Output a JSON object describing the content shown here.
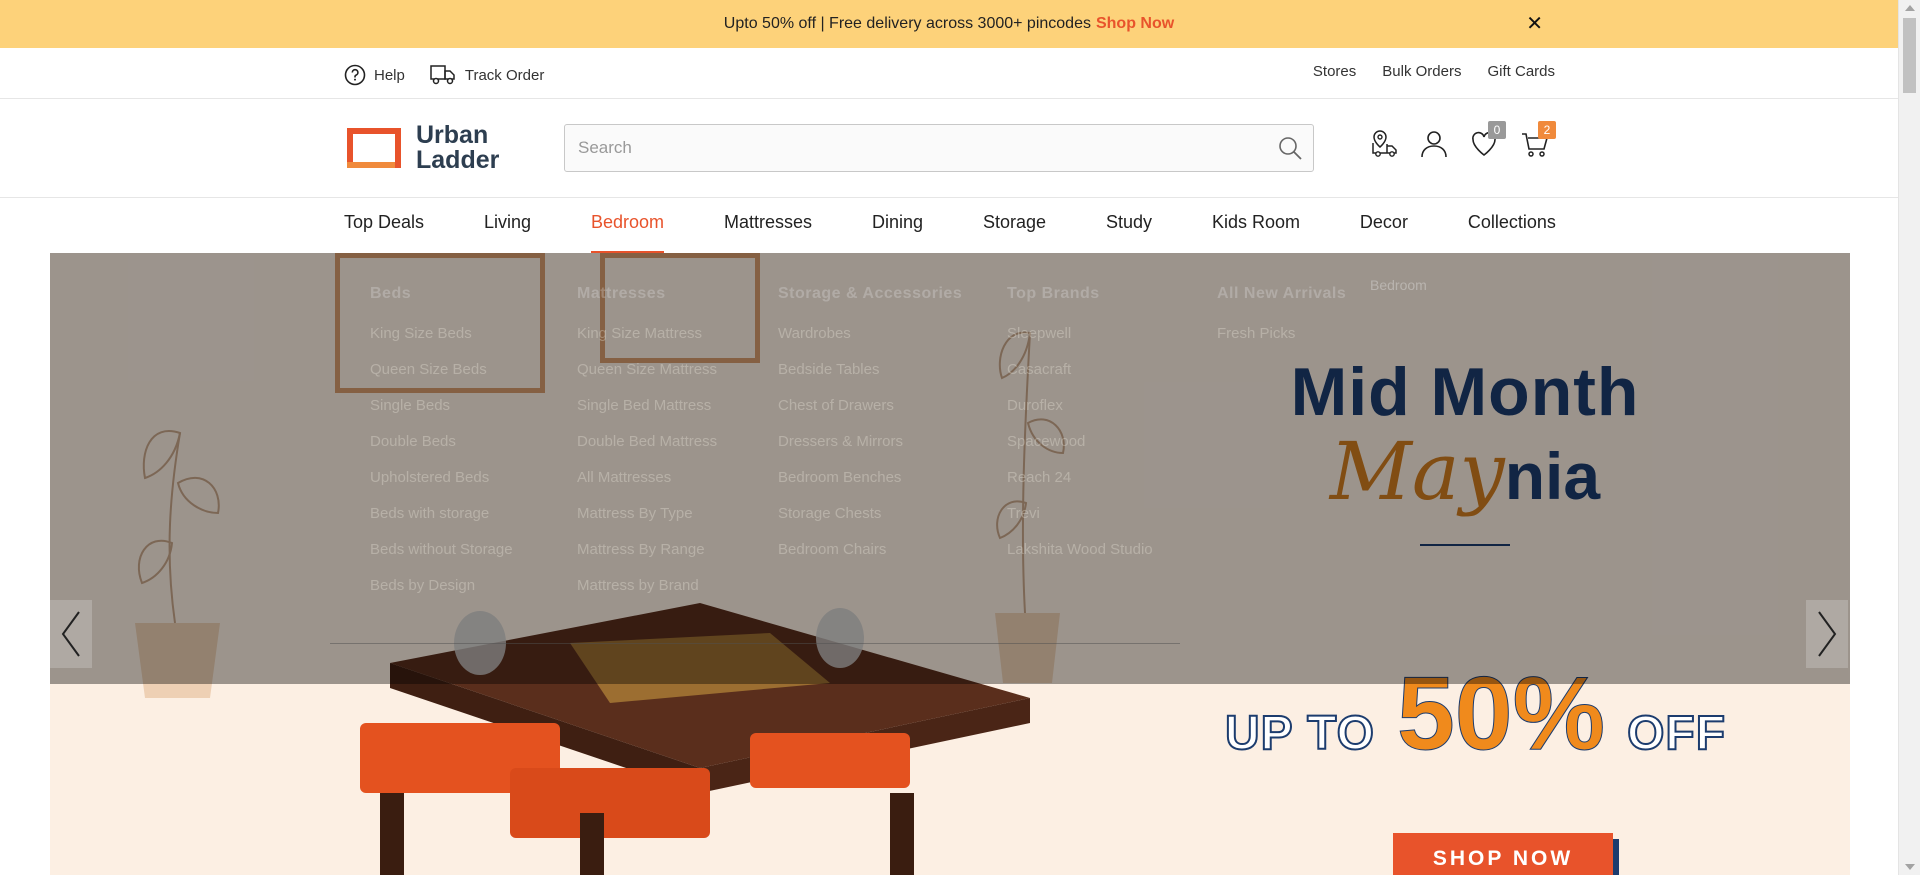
{
  "promo": {
    "text": "Upto 50% off | Free delivery across 3000+ pincodes",
    "link": "Shop Now",
    "close": "✕"
  },
  "util": {
    "help": "Help",
    "track": "Track Order",
    "stores": "Stores",
    "bulk": "Bulk Orders",
    "gift": "Gift Cards"
  },
  "brand": {
    "line1": "Urban",
    "line2": "Ladder"
  },
  "search": {
    "placeholder": "Search",
    "value": ""
  },
  "header": {
    "wishlist_count": "0",
    "cart_count": "2"
  },
  "nav": [
    "Top Deals",
    "Living",
    "Bedroom",
    "Mattresses",
    "Dining",
    "Storage",
    "Study",
    "Kids Room",
    "Decor",
    "Collections"
  ],
  "nav_active": "Bedroom",
  "mega": {
    "beds": {
      "title": "Beds",
      "items": [
        "King Size Beds",
        "Queen Size Beds",
        "Single Beds",
        "Double Beds",
        "Upholstered Beds",
        "Beds with storage",
        "Beds without Storage",
        "Beds by Design"
      ]
    },
    "mattresses": {
      "title": "Mattresses",
      "items": [
        "King Size Mattress",
        "Queen Size Mattress",
        "Single Bed Mattress",
        "Double Bed Mattress",
        "All Mattresses",
        "Mattress By Type",
        "Mattress By Range",
        "Mattress by Brand"
      ]
    },
    "storage": {
      "title": "Storage & Accessories",
      "items": [
        "Wardrobes",
        "Bedside Tables",
        "Chest of Drawers",
        "Dressers & Mirrors",
        "Bedroom Benches",
        "Storage Chests",
        "Bedroom Chairs"
      ]
    },
    "brands": {
      "title": "Top Brands",
      "items": [
        "Sleepwell",
        "Casacraft",
        "Duroflex",
        "Spacewood",
        "Reach 24",
        "Trevi",
        "Lakshita Wood Studio"
      ]
    },
    "arrivals": {
      "title": "All New Arrivals",
      "items": [
        "Fresh Picks"
      ]
    },
    "image_alt": "Bedroom"
  },
  "hero": {
    "line1": "Mid Month",
    "may_a": "May",
    "may_b": "nia",
    "upto": "UP TO",
    "percent": "50%",
    "off": "OFF",
    "cta": "SHOP NOW"
  },
  "colors": {
    "accent": "#e8532b",
    "promo_bg": "#fdd27a",
    "navy": "#1c3c6e",
    "hero_bg": "#fcefe3"
  }
}
